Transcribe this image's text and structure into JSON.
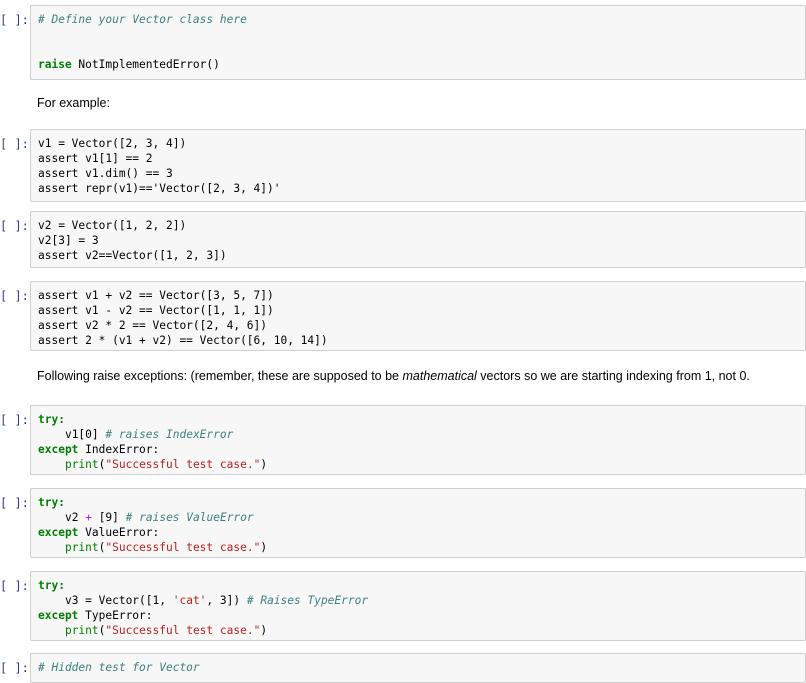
{
  "prompt_label": "[ ]:",
  "cells": {
    "c1": {
      "line1": "# Define your Vector class here",
      "line2_kw": "raise",
      "line2_rest": " NotImplementedError()"
    },
    "md1": "For example:",
    "c2": [
      "v1 = Vector([2, 3, 4])",
      "assert v1[1] == 2",
      "assert v1.dim() == 3",
      "assert repr(v1)=='Vector([2, 3, 4])'"
    ],
    "c3": [
      "v2 = Vector([1, 2, 2])",
      "v2[3] = 3",
      "assert v2==Vector([1, 2, 3])"
    ],
    "c4": [
      "assert v1 + v2 == Vector([3, 5, 7])",
      "assert v1 - v2 == Vector([1, 1, 1])",
      "assert v2 * 2 == Vector([2, 4, 6])",
      "assert 2 * (v1 + v2) == Vector([6, 10, 14])"
    ],
    "md2": {
      "before": "Following raise exceptions: (remember, these are supposed to be ",
      "emph": "mathematical",
      "after": " vectors so we are starting indexing from 1, not 0."
    },
    "c5": {
      "try": "try:",
      "body": "v1[0]",
      "comment": "# raises IndexError",
      "except_kw": "except",
      "except_name": " IndexError:",
      "print_fn": "print",
      "print_str": "\"Successful test case.\""
    },
    "c6": {
      "try": "try:",
      "body_a": "v2",
      "body_op": "+",
      "body_b": "[9]",
      "comment": "# raises ValueError",
      "except_kw": "except",
      "except_name": " ValueError:",
      "print_fn": "print",
      "print_str": "\"Successful test case.\""
    },
    "c7": {
      "try": "try:",
      "body_a": "v3 = Vector([1, ",
      "body_str": "'cat'",
      "body_b": ", 3])",
      "comment": "# Raises TypeError",
      "except_kw": "except",
      "except_name": " TypeError:",
      "print_fn": "print",
      "print_str": "\"Successful test case.\""
    },
    "c8": {
      "comment": "# Hidden test for Vector"
    }
  }
}
